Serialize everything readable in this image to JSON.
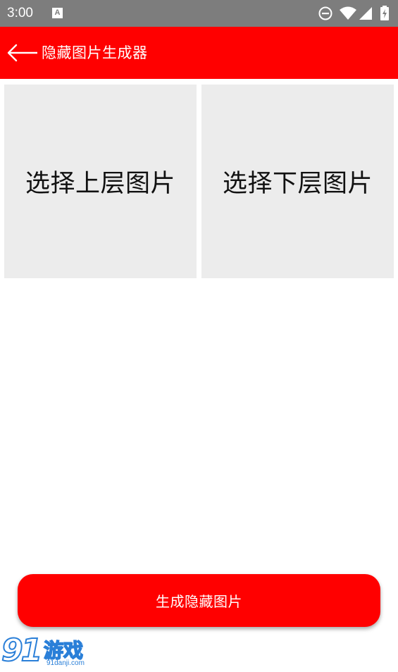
{
  "status_bar": {
    "time": "3:00",
    "notification_icon": "A",
    "icons": [
      "do-not-disturb-icon",
      "wifi-icon",
      "signal-icon",
      "battery-charging-icon"
    ]
  },
  "app_bar": {
    "title": "隐藏图片生成器",
    "back_icon": "back-arrow-icon",
    "color": "#ff0000"
  },
  "tiles": {
    "upper_label": "选择上层图片",
    "lower_label": "选择下层图片",
    "color": "#ececec"
  },
  "generate_button": {
    "label": "生成隐藏图片",
    "color": "#ff0000"
  },
  "watermark": {
    "number": "91",
    "name": "游戏",
    "url": "91danji.com"
  }
}
